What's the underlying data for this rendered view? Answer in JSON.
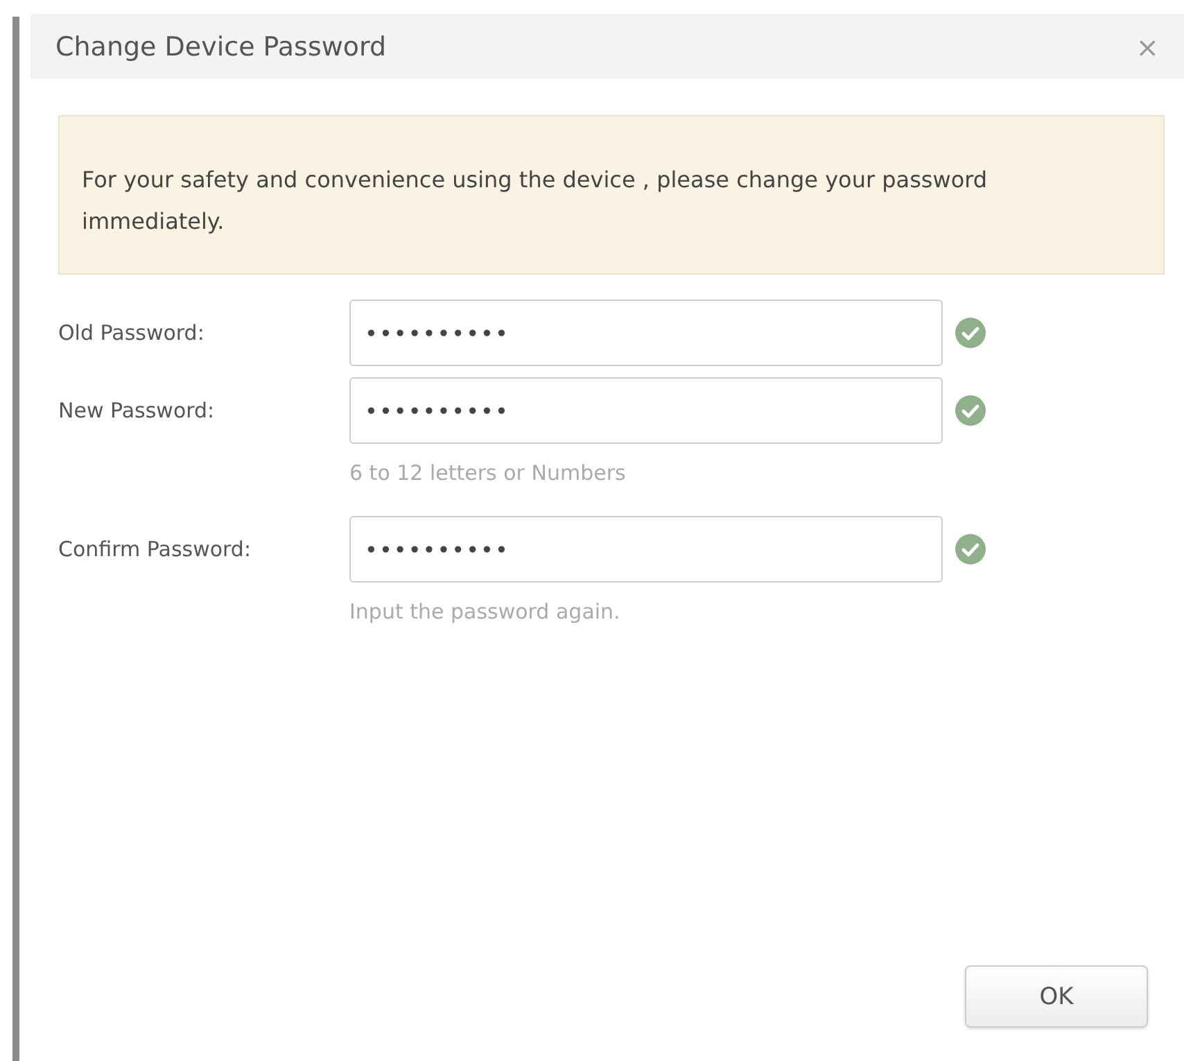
{
  "dialog": {
    "title": "Change Device Password",
    "close": "×"
  },
  "notice": "For your safety and convenience using the device , please change your password immediately.",
  "fields": [
    {
      "label": "Old Password:",
      "value": "••••••••••",
      "valid": true
    },
    {
      "label": "New Password:",
      "value": "••••••••••",
      "valid": true,
      "hint": "6 to 12 letters or Numbers"
    },
    {
      "label": "Confirm Password:",
      "value": "••••••••••",
      "valid": true,
      "hint": "Input the password again."
    }
  ],
  "buttons": [
    "OK"
  ]
}
